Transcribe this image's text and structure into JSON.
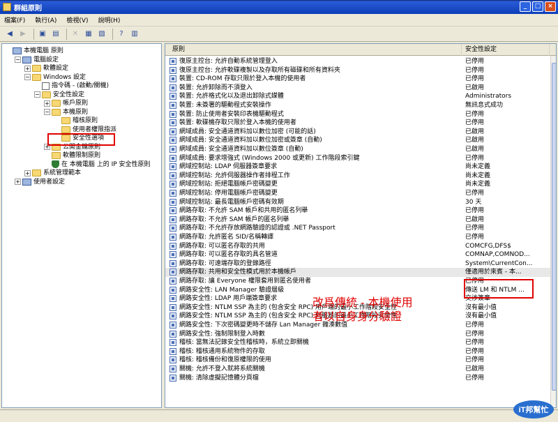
{
  "window": {
    "title": "群組原則"
  },
  "menu": [
    "檔案(F)",
    "執行(A)",
    "檢視(V)",
    "說明(H)"
  ],
  "tree": [
    {
      "label": "本機電腦 原則",
      "indent": 0,
      "icon": "pc-icon",
      "exp": ""
    },
    {
      "label": "電腦設定",
      "indent": 1,
      "icon": "pc-icon",
      "exp": "−"
    },
    {
      "label": "軟體設定",
      "indent": 2,
      "icon": "folder-icon",
      "exp": "+"
    },
    {
      "label": "Windows 設定",
      "indent": 2,
      "icon": "folder-icon",
      "exp": "−"
    },
    {
      "label": "指令碼 - (啟動/關機)",
      "indent": 3,
      "icon": "doc-icon",
      "exp": ""
    },
    {
      "label": "安全性設定",
      "indent": 3,
      "icon": "folder-icon",
      "exp": "−"
    },
    {
      "label": "帳戶原則",
      "indent": 4,
      "icon": "folder-icon",
      "exp": "+"
    },
    {
      "label": "本機原則",
      "indent": 4,
      "icon": "folder-icon",
      "exp": "−"
    },
    {
      "label": "稽核原則",
      "indent": 5,
      "icon": "folder-icon",
      "exp": ""
    },
    {
      "label": "使用者權限指派",
      "indent": 5,
      "icon": "folder-icon",
      "exp": ""
    },
    {
      "label": "安全性選項",
      "indent": 5,
      "icon": "folder-icon",
      "exp": ""
    },
    {
      "label": "公開金鑰原則",
      "indent": 4,
      "icon": "folder-icon",
      "exp": "+"
    },
    {
      "label": "軟體限制原則",
      "indent": 4,
      "icon": "folder-icon",
      "exp": ""
    },
    {
      "label": "在 本機電腦 上的 IP 安全性原則",
      "indent": 4,
      "icon": "shield-icon",
      "exp": ""
    },
    {
      "label": "系統管理範本",
      "indent": 2,
      "icon": "folder-icon",
      "exp": "+"
    },
    {
      "label": "使用者設定",
      "indent": 1,
      "icon": "pc-icon",
      "exp": "+"
    }
  ],
  "columns": {
    "policy": "原則",
    "setting": "安全性設定"
  },
  "policies": [
    [
      "復原主控台: 允許自動系統管理登入",
      "已停用"
    ],
    [
      "復原主控台: 允許軟碟複製以及存取所有磁碟和所有資料夾",
      "已停用"
    ],
    [
      "裝置: CD-ROM 存取只限於登入本機的使用者",
      "已停用"
    ],
    [
      "裝置: 允許卸除而不須登入",
      "已啟用"
    ],
    [
      "裝置: 允許格式化以及退出卸除式媒體",
      "Administrators"
    ],
    [
      "裝置: 未簽署的驅動程式安裝操作",
      "無訊息式成功"
    ],
    [
      "裝置: 防止使用者安裝印表機驅動程式",
      "已停用"
    ],
    [
      "裝置: 軟碟機存取只限於登入本機的使用者",
      "已停用"
    ],
    [
      "網域成員: 安全通道資料加以數位加密 (可能的話)",
      "已啟用"
    ],
    [
      "網域成員: 安全通道資料加以數位加密或簽章 (自動)",
      "已啟用"
    ],
    [
      "網域成員: 安全通道資料加以數位簽章 (自動)",
      "已啟用"
    ],
    [
      "網域成員: 要求增強式 (Windows 2000 或更新) 工作階段索引鍵",
      "已停用"
    ],
    [
      "網域控制站: LDAP 伺服器簽章要求",
      "尚未定義"
    ],
    [
      "網域控制站: 允許伺服器操作者排程工作",
      "尚未定義"
    ],
    [
      "網域控制站: 拒絕電腦帳戶密碼變更",
      "尚未定義"
    ],
    [
      "網域控制站: 停用電腦帳戶密碼變更",
      "已停用"
    ],
    [
      "網域控制站: 最長電腦帳戶密碼有效期",
      "30 天"
    ],
    [
      "網路存取: 不允許 SAM 帳戶和共用的匿名列舉",
      "已停用"
    ],
    [
      "網路存取: 不允許 SAM 帳戶的匿名列舉",
      "已啟用"
    ],
    [
      "網路存取: 不允許存放網路驗證的認證或 .NET Passport",
      "已停用"
    ],
    [
      "網路存取: 允許匿名 SID/名稱轉譯",
      "已停用"
    ],
    [
      "網路存取: 可以匿名存取的共用",
      "COMCFG,DFS$"
    ],
    [
      "網路存取: 可以匿名存取的具名管道",
      "COMNAP,COMNOD..."
    ],
    [
      "網路存取: 可遠端存取的登錄路徑",
      "System\\CurrentCon..."
    ],
    [
      "網路存取: 共用和安全性模式用於本機帳戶",
      "僅適用於來賓 - 本..."
    ],
    [
      "網路存取: 讓 Everyone 權限套用到匿名使用者",
      "已停用"
    ],
    [
      "網路安全性: LAN Manager 驗證層級",
      "傳送 LM 和 NTLM ..."
    ],
    [
      "網路安全性: LDAP 用戶端簽章要求",
      "交涉簽章"
    ],
    [
      "網路安全性: NTLM SSP 為主的 (包含安全 RPC) 用戶端的最小工作階段安全性",
      "沒有最小值"
    ],
    [
      "網路安全性: NTLM SSP 為主的 (包含安全 RPC) 伺服器的最小工作階段安全性",
      "沒有最小值"
    ],
    [
      "網路安全性: 下次密碼變更時不儲存 Lan Manager 雜湊數值",
      "已停用"
    ],
    [
      "網路安全性: 強制限制登入時數",
      "已停用"
    ],
    [
      "稽核: 當無法記錄安全性稽核時，系統立即關機",
      "已停用"
    ],
    [
      "稽核: 稽核通用系統物件的存取",
      "已停用"
    ],
    [
      "稽核: 稽核備份和復原權限的使用",
      "已停用"
    ],
    [
      "關機: 允許不登入就將系統關機",
      "已啟用"
    ],
    [
      "關機: 清除虛擬記憶體分頁檔",
      "已停用"
    ]
  ],
  "selected_row": 24,
  "annotation": {
    "line1": "改爲傳統 - 本機使用",
    "line2": "者以自身身分驗證"
  },
  "watermark": {
    "text": "iT邦幫忙"
  },
  "colors": {
    "highlight": "#E00000",
    "titlebar": "#0A3DB8"
  }
}
